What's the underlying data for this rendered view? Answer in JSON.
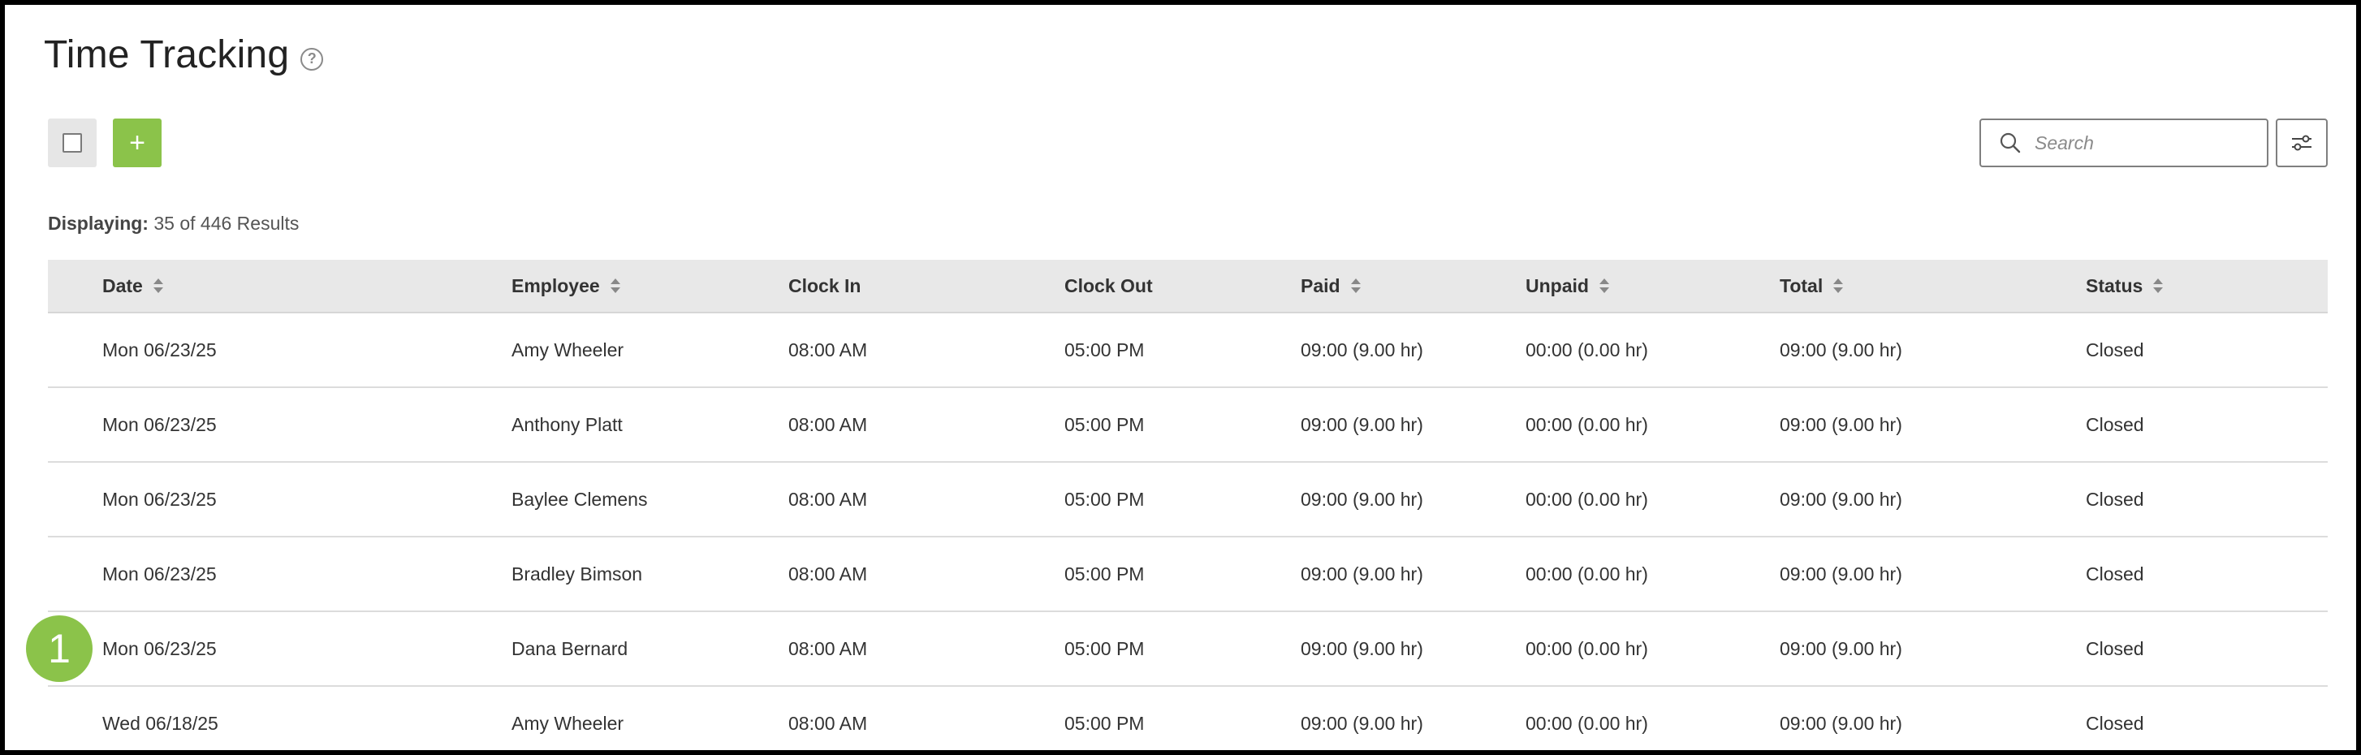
{
  "page": {
    "title": "Time Tracking",
    "help_icon": "question-circle-icon"
  },
  "toolbar": {
    "add_label": "+",
    "search_placeholder": "Search",
    "search_icon": "search-icon",
    "filter_icon": "sliders-icon",
    "accent_color": "#8bc34a"
  },
  "results": {
    "label": "Displaying:",
    "text": "35 of 446 Results"
  },
  "table": {
    "columns": [
      {
        "label": "Date",
        "sortable": true
      },
      {
        "label": "Employee",
        "sortable": true
      },
      {
        "label": "Clock In",
        "sortable": false
      },
      {
        "label": "Clock Out",
        "sortable": false
      },
      {
        "label": "Paid",
        "sortable": true
      },
      {
        "label": "Unpaid",
        "sortable": true
      },
      {
        "label": "Total",
        "sortable": true
      },
      {
        "label": "Status",
        "sortable": true
      }
    ],
    "rows": [
      {
        "date": "Mon 06/23/25",
        "employee": "Amy Wheeler",
        "clock_in": "08:00 AM",
        "clock_out": "05:00 PM",
        "paid": "09:00 (9.00 hr)",
        "unpaid": "00:00 (0.00 hr)",
        "total": "09:00 (9.00 hr)",
        "status": "Closed"
      },
      {
        "date": "Mon 06/23/25",
        "employee": "Anthony Platt",
        "clock_in": "08:00 AM",
        "clock_out": "05:00 PM",
        "paid": "09:00 (9.00 hr)",
        "unpaid": "00:00 (0.00 hr)",
        "total": "09:00 (9.00 hr)",
        "status": "Closed"
      },
      {
        "date": "Mon 06/23/25",
        "employee": "Baylee Clemens",
        "clock_in": "08:00 AM",
        "clock_out": "05:00 PM",
        "paid": "09:00 (9.00 hr)",
        "unpaid": "00:00 (0.00 hr)",
        "total": "09:00 (9.00 hr)",
        "status": "Closed"
      },
      {
        "date": "Mon 06/23/25",
        "employee": "Bradley Bimson",
        "clock_in": "08:00 AM",
        "clock_out": "05:00 PM",
        "paid": "09:00 (9.00 hr)",
        "unpaid": "00:00 (0.00 hr)",
        "total": "09:00 (9.00 hr)",
        "status": "Closed"
      },
      {
        "date": "Mon 06/23/25",
        "employee": "Dana Bernard",
        "clock_in": "08:00 AM",
        "clock_out": "05:00 PM",
        "paid": "09:00 (9.00 hr)",
        "unpaid": "00:00 (0.00 hr)",
        "total": "09:00 (9.00 hr)",
        "status": "Closed"
      },
      {
        "date": "Wed 06/18/25",
        "employee": "Amy Wheeler",
        "clock_in": "08:00 AM",
        "clock_out": "05:00 PM",
        "paid": "09:00 (9.00 hr)",
        "unpaid": "00:00 (0.00 hr)",
        "total": "09:00 (9.00 hr)",
        "status": "Closed"
      }
    ]
  },
  "step_badge": {
    "number": "1"
  }
}
